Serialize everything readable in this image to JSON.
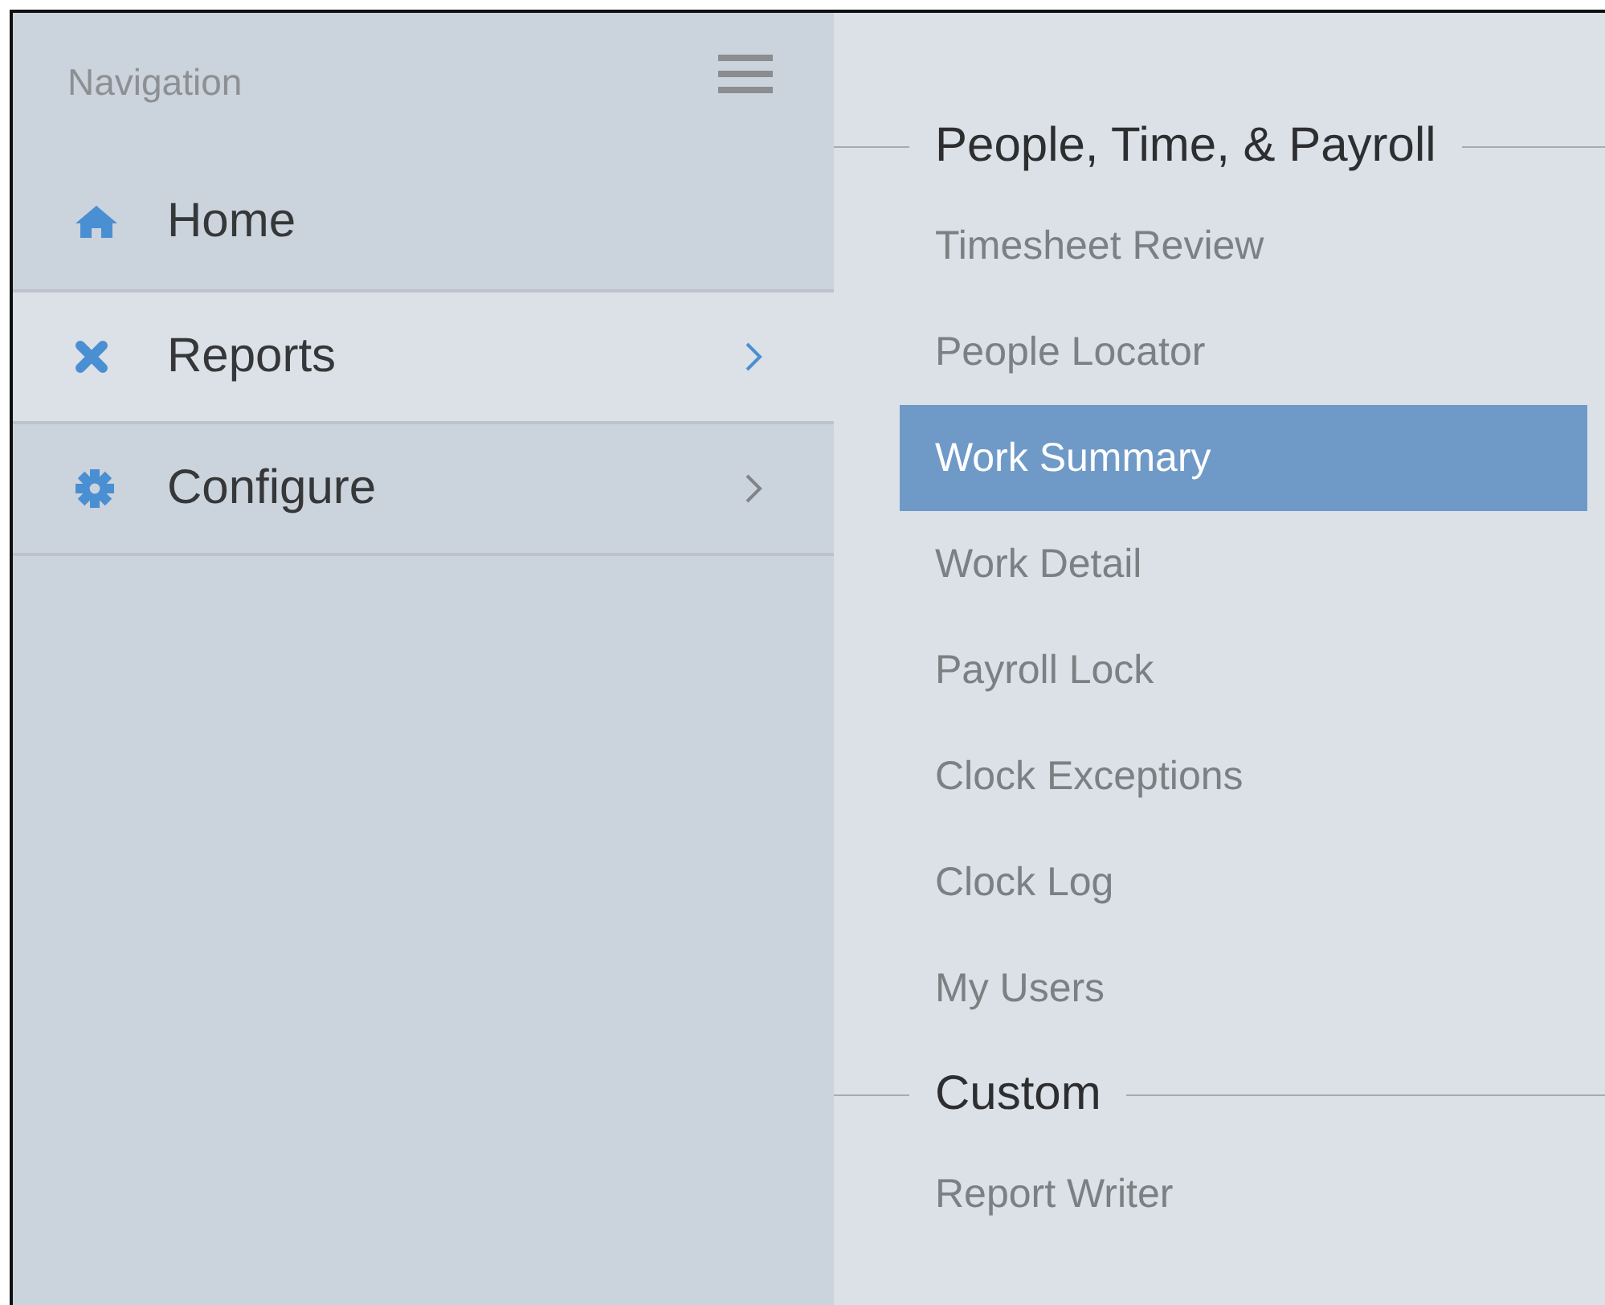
{
  "navigation": {
    "title": "Navigation",
    "items": [
      {
        "label": "Home",
        "kind": "home",
        "selected": false,
        "submenu": false
      },
      {
        "label": "Reports",
        "kind": "cross",
        "selected": true,
        "submenu": true
      },
      {
        "label": "Configure",
        "kind": "gear",
        "selected": false,
        "submenu": true
      }
    ]
  },
  "sections": [
    {
      "title": "People, Time, & Payroll",
      "items": [
        {
          "label": "Timesheet Review",
          "selected": false
        },
        {
          "label": "People Locator",
          "selected": false
        },
        {
          "label": "Work Summary",
          "selected": true
        },
        {
          "label": "Work Detail",
          "selected": false
        },
        {
          "label": "Payroll Lock",
          "selected": false
        },
        {
          "label": "Clock Exceptions",
          "selected": false
        },
        {
          "label": "Clock Log",
          "selected": false
        },
        {
          "label": "My Users",
          "selected": false
        }
      ]
    },
    {
      "title": "Custom",
      "items": [
        {
          "label": "Report Writer",
          "selected": false
        }
      ]
    }
  ]
}
